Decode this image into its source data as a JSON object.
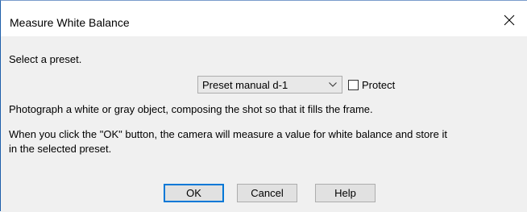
{
  "window": {
    "title": "Measure White Balance",
    "close_icon": "close-icon"
  },
  "content": {
    "select_label": "Select a preset.",
    "preset_select": {
      "value": "Preset manual d-1",
      "icon": "chevron-down-icon"
    },
    "protect_checkbox": {
      "label": "Protect",
      "checked": false
    },
    "instruction": "Photograph a white or gray object, composing the shot so that it fills the frame.",
    "info_line1": "When you click the \"OK\" button, the camera will measure a value for white balance and store it",
    "info_line2": "in the selected preset."
  },
  "buttons": {
    "ok": "OK",
    "cancel": "Cancel",
    "help": "Help"
  },
  "colors": {
    "accent": "#0078d7",
    "dialog_bg": "#f0f0f0",
    "titlebar_bg": "#ffffff"
  }
}
